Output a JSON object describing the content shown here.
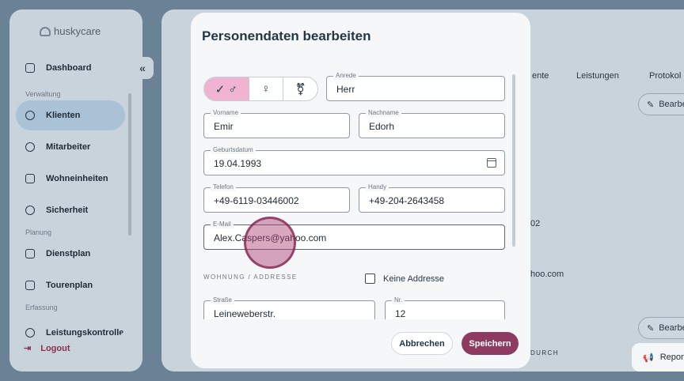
{
  "sidebar": {
    "logo": "huskycare",
    "collapse_icon": "«",
    "sections": [
      "Verwaltung",
      "Planung",
      "Erfassung"
    ],
    "items": [
      {
        "label": "Dashboard"
      },
      {
        "label": "Klienten"
      },
      {
        "label": "Mitarbeiter"
      },
      {
        "label": "Wohneinheiten"
      },
      {
        "label": "Sicherheit"
      },
      {
        "label": "Dienstplan"
      },
      {
        "label": "Tourenplan"
      },
      {
        "label": "Leistungskontrolle"
      }
    ],
    "logout": "Logout"
  },
  "background": {
    "tabs": [
      "ente",
      "Leistungen",
      "Protokol"
    ],
    "edit_label": "Bearbe",
    "partial_phone": "02",
    "partial_email": "hoo.com",
    "partial_section": "DURCH",
    "report_label": "Report a"
  },
  "modal": {
    "title": "Personendaten bearbeiten",
    "gender": {
      "options": [
        "✓ ♂",
        "♀",
        "⚧"
      ],
      "selected": 0
    },
    "fields": {
      "anrede": {
        "label": "Anrede",
        "value": "Herr"
      },
      "vorname": {
        "label": "Vorname",
        "value": "Emir"
      },
      "nachname": {
        "label": "Nachname",
        "value": "Edorh"
      },
      "geburtsdatum": {
        "label": "Geburtsdatum",
        "value": "19.04.1993"
      },
      "telefon": {
        "label": "Telefon",
        "value": "+49-6119-03446002"
      },
      "handy": {
        "label": "Handy",
        "value": "+49-204-2643458"
      },
      "email": {
        "label": "E-Mail",
        "value": "Alex.Caspers@yahoo.com"
      },
      "strasse": {
        "label": "Straße",
        "value": "Leineweberstr."
      },
      "nr": {
        "label": "Nr.",
        "value": "12"
      }
    },
    "address_section": "WOHNUNG / ADDRESSE",
    "no_address": {
      "label": "Keine Addresse",
      "checked": false
    },
    "cancel_label": "Abbrechen",
    "save_label": "Speichern"
  },
  "colors": {
    "accent": "#8e3b62",
    "gender_selected": "#f0b3d1"
  }
}
